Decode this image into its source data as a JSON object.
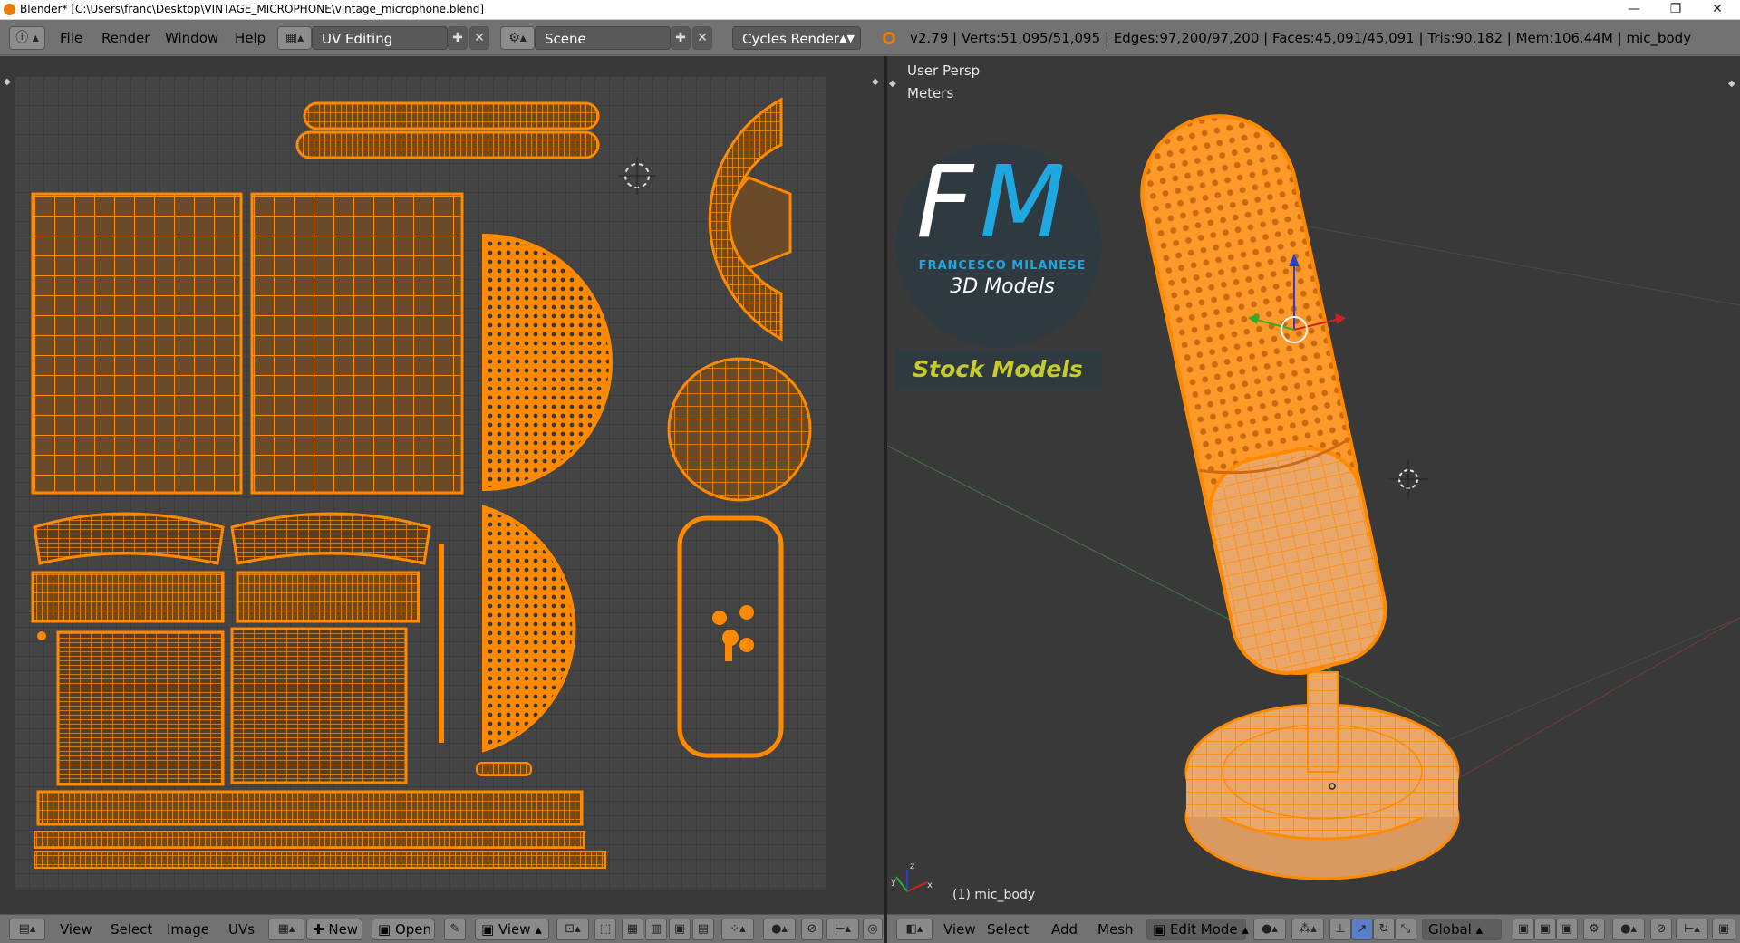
{
  "window": {
    "title": "Blender* [C:\\Users\\franc\\Desktop\\VINTAGE_MICROPHONE\\vintage_microphone.blend]",
    "minimize": "—",
    "maximize": "❐",
    "close": "✕"
  },
  "topbar": {
    "menus": [
      "File",
      "Render",
      "Window",
      "Help"
    ],
    "screen_layout": "UV Editing",
    "scene": "Scene",
    "render_engine": "Cycles Render",
    "stats": "v2.79 | Verts:51,095/51,095 | Edges:97,200/97,200 | Faces:45,091/45,091 | Tris:90,182 | Mem:106.44M | mic_body"
  },
  "uv_editor": {
    "menus": [
      "View",
      "Select",
      "Image",
      "UVs"
    ],
    "new_label": "New",
    "open_label": "Open",
    "view_label": "View"
  },
  "viewport": {
    "persp_label": "User Persp",
    "units_label": "Meters",
    "object_label": "(1) mic_body",
    "menus": [
      "View",
      "Select",
      "Add",
      "Mesh"
    ],
    "mode": "Edit Mode",
    "orientation": "Global"
  },
  "logo": {
    "letters_f": "F",
    "letters_m": "M",
    "name": "FRANCESCO MILANESE",
    "subtitle": "3D Models",
    "tagline": "Stock Models"
  },
  "colors": {
    "uv_orange": "#ff8a00",
    "uv_bg": "#393939",
    "header": "#727272",
    "logo_blue": "#1fa7e0",
    "logo_yellow": "#c8cc2a"
  }
}
